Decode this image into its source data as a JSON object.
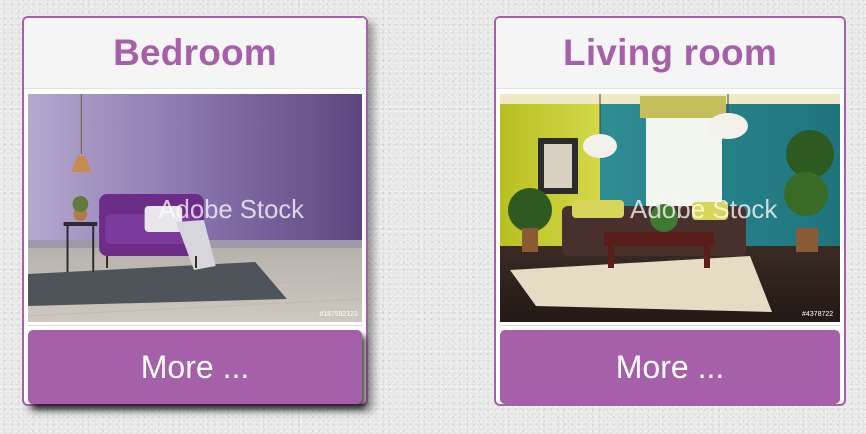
{
  "cards": [
    {
      "title": "Bedroom",
      "image": {
        "watermark": "Adobe Stock",
        "stock_id": "#187592123"
      },
      "button_label": "More ..."
    },
    {
      "title": "Living room",
      "image": {
        "watermark": "Adobe Stock",
        "stock_id": "#4378722"
      },
      "button_label": "More ..."
    }
  ],
  "colors": {
    "accent": "#a65fa9",
    "header_bg": "#f5f5f5",
    "button_text": "#ffffff"
  }
}
